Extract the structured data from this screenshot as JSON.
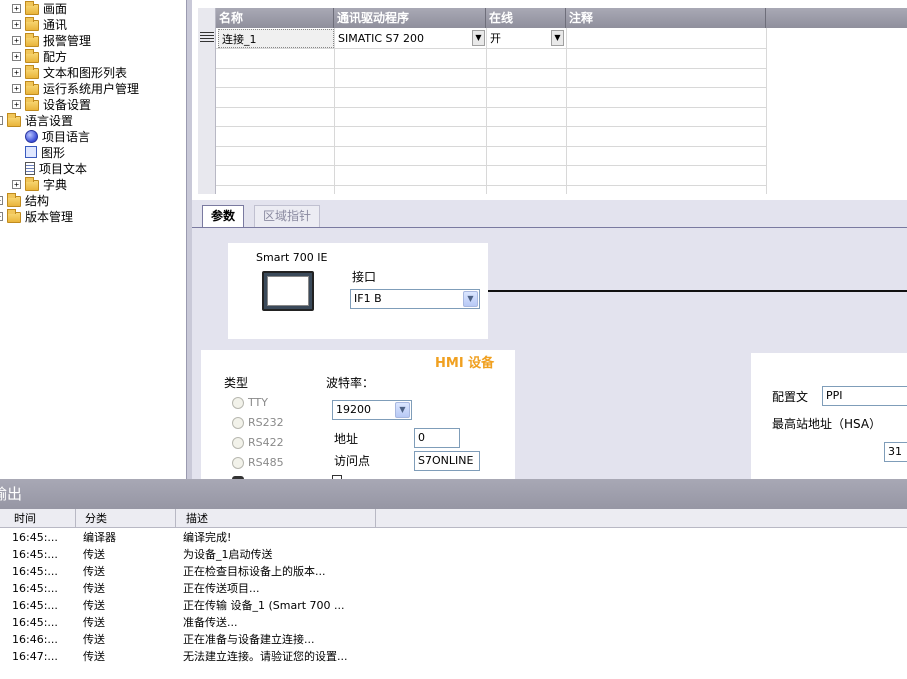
{
  "tree": {
    "items": [
      {
        "label": "画面",
        "icon": "folder-icon",
        "toggle": "+"
      },
      {
        "label": "通讯",
        "icon": "folder-icon",
        "toggle": "+"
      },
      {
        "label": "报警管理",
        "icon": "folder-icon",
        "toggle": "+"
      },
      {
        "label": "配方",
        "icon": "folder-icon",
        "toggle": "+"
      },
      {
        "label": "文本和图形列表",
        "icon": "folder-icon",
        "toggle": "+"
      },
      {
        "label": "运行系统用户管理",
        "icon": "folder-icon",
        "toggle": "+"
      },
      {
        "label": "设备设置",
        "icon": "folder-icon",
        "toggle": "+"
      },
      {
        "label": "语言设置",
        "icon": "folder-icon",
        "toggle": "-"
      },
      {
        "label": "项目语言",
        "icon": "globe-icon",
        "toggle": ""
      },
      {
        "label": "图形",
        "icon": "image-icon",
        "toggle": ""
      },
      {
        "label": "项目文本",
        "icon": "document-icon",
        "toggle": ""
      },
      {
        "label": "字典",
        "icon": "folder-icon",
        "toggle": "+"
      },
      {
        "label": "结构",
        "icon": "folder-icon",
        "toggle": "+"
      },
      {
        "label": "版本管理",
        "icon": "folder-icon",
        "toggle": "+"
      }
    ]
  },
  "grid": {
    "headers": [
      "名称",
      "通讯驱动程序",
      "在线",
      "注释"
    ],
    "row": {
      "name": "连接_1",
      "driver": "SIMATIC S7 200",
      "online": "开",
      "comment": ""
    }
  },
  "props": {
    "tabs": [
      "参数",
      "区域指针"
    ],
    "device_name": "Smart 700 IE",
    "interface_label": "接口",
    "interface_value": "IF1 B",
    "hmi_title": "HMI 设备",
    "type_label": "类型",
    "types": [
      "TTY",
      "RS232",
      "RS422",
      "RS485"
    ],
    "baud_label": "波特率：",
    "baud_value": "19200",
    "address_label": "地址",
    "address_value": "0",
    "access_label": "访问点",
    "access_value": "S7ONLINE",
    "profile_label": "配置文",
    "profile_value": "PPI",
    "hsa_label": "最高站地址（HSA）",
    "hsa_value": "31"
  },
  "output": {
    "title": "输出",
    "headers": [
      "时间",
      "分类",
      "描述"
    ],
    "rows": [
      {
        "time": "16:45:...",
        "cat": "编译器",
        "desc": "编译完成!"
      },
      {
        "time": "16:45:...",
        "cat": "传送",
        "desc": "为设备_1启动传送"
      },
      {
        "time": "16:45:...",
        "cat": "传送",
        "desc": "正在检查目标设备上的版本..."
      },
      {
        "time": "16:45:...",
        "cat": "传送",
        "desc": "正在传送项目..."
      },
      {
        "time": "16:45:...",
        "cat": "传送",
        "desc": "正在传输  设备_1 (Smart 700 ..."
      },
      {
        "time": "16:45:...",
        "cat": "传送",
        "desc": "准备传送..."
      },
      {
        "time": "16:46:...",
        "cat": "传送",
        "desc": "正在准备与设备建立连接..."
      },
      {
        "time": "16:47:...",
        "cat": "传送",
        "desc": "无法建立连接。请验证您的设置..."
      }
    ]
  }
}
